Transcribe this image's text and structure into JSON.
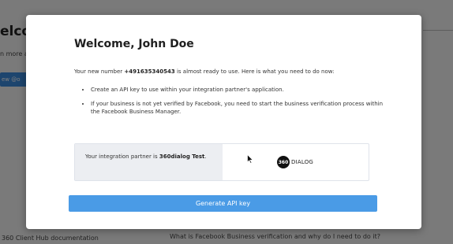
{
  "background": {
    "title": "elcom",
    "subtitle": "n more al",
    "button_label": "ew @o",
    "footer_left": "360 Client Hub documentation",
    "footer_right": "What is Facebook Business verification and why do I need to do it?"
  },
  "modal": {
    "title": "Welcome, John Doe",
    "intro_prefix": "Your new number ",
    "phone_number": "+491635340543",
    "intro_suffix": " is almost ready to use. Here is what you need to do now:",
    "bullets": [
      "Create an API key to use within your integration partner's application.",
      "If your business is not yet verified by Facebook, you need to start the business verification process within the Facebook Business Manager."
    ],
    "partner_prefix": "Your integration partner is ",
    "partner_name": "360dialog Test",
    "partner_suffix": ".",
    "logo_mark": "360",
    "logo_word": "DIALOG",
    "generate_label": "Generate API key"
  },
  "colors": {
    "accent": "#4a9be6",
    "overlay": "rgba(0,0,0,0.5)"
  },
  "icons": {
    "cursor": "mouse-cursor-icon"
  }
}
